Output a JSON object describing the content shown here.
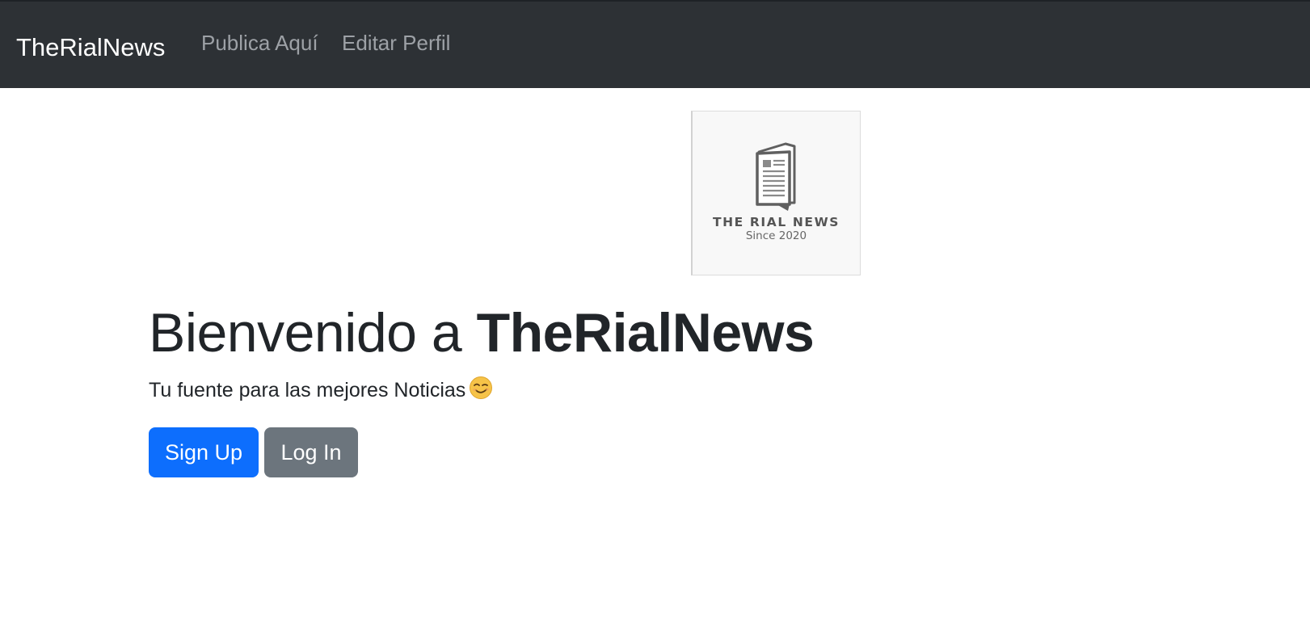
{
  "navbar": {
    "brand": "TheRialNews",
    "links": [
      {
        "label": "Publica Aquí"
      },
      {
        "label": "Editar Perfil"
      }
    ],
    "background": "#2d3135"
  },
  "logo": {
    "title": "THE RIAL NEWS",
    "subtitle": "Since 2020",
    "icon": "newspaper-icon"
  },
  "hero": {
    "heading_prefix": "Bienvenido a",
    "heading_strong": "TheRialNews",
    "tagline": "Tu fuente para las mejores Noticias",
    "tagline_emoji": "winking-face-emoji"
  },
  "buttons": {
    "signup_label": "Sign Up",
    "login_label": "Log In",
    "signup_color": "#0d6efd",
    "login_color": "#6c757d"
  }
}
